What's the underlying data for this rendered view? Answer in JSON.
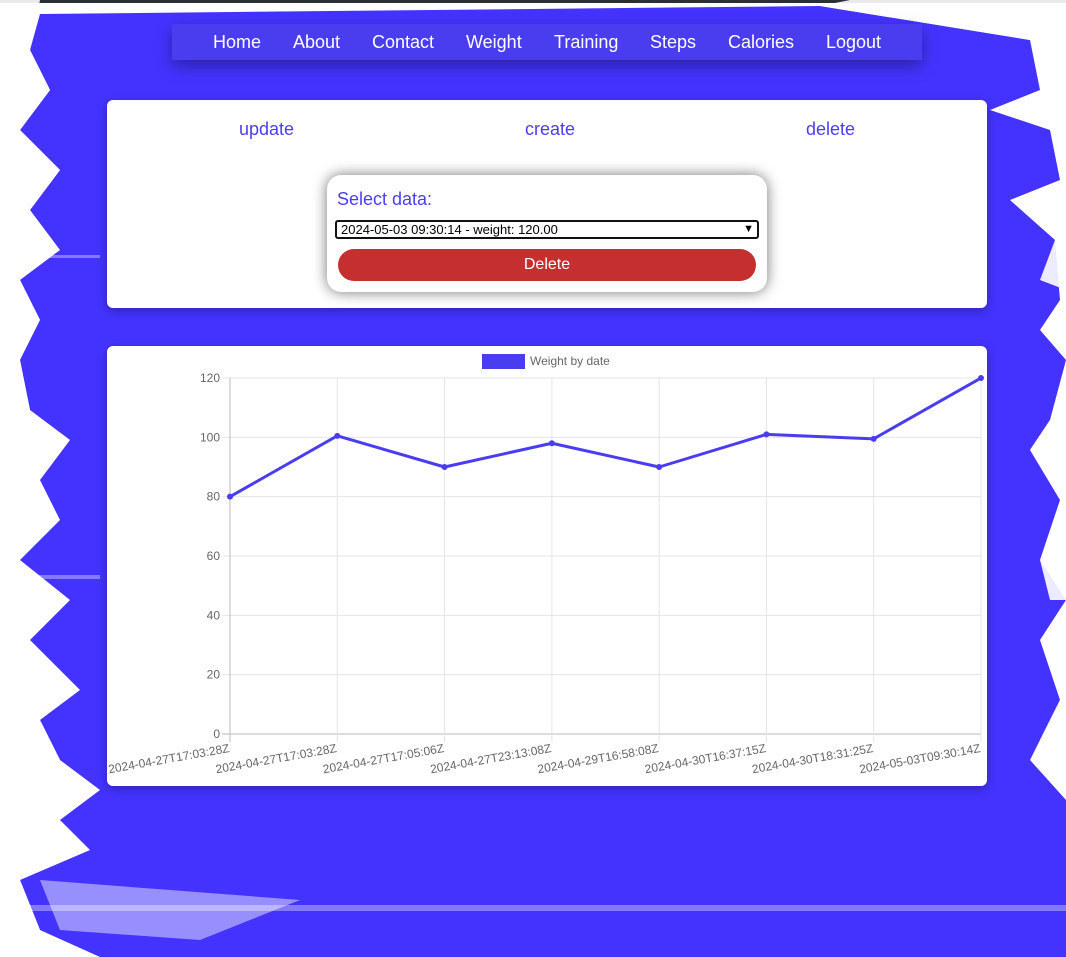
{
  "nav": {
    "items": [
      "Home",
      "About",
      "Contact",
      "Weight",
      "Training",
      "Steps",
      "Calories",
      "Logout"
    ]
  },
  "crud": {
    "update": "update",
    "create": "create",
    "delete": "delete"
  },
  "form": {
    "label": "Select data:",
    "selected_option": "2024-05-03 09:30:14 - weight: 120.00",
    "delete_button": "Delete"
  },
  "colors": {
    "accent": "#4a3df0",
    "delete": "#c62f2f"
  },
  "icons": {
    "select_arrow": "chevron-down-icon"
  },
  "chart_data": {
    "type": "line",
    "legend": "Weight by date",
    "legend_position": "top",
    "categories": [
      "2024-04-27T17:03:28Z",
      "2024-04-27T17:03:28Z",
      "2024-04-27T17:05:06Z",
      "2024-04-27T23:13:08Z",
      "2024-04-29T16:58:08Z",
      "2024-04-30T16:37:15Z",
      "2024-04-30T18:31:25Z",
      "2024-05-03T09:30:14Z"
    ],
    "series": [
      {
        "name": "Weight by date",
        "values": [
          80,
          100.5,
          90,
          98,
          90,
          101,
          99.5,
          120
        ]
      }
    ],
    "y_ticks": [
      "120",
      "100",
      "80",
      "60",
      "40",
      "20",
      "0"
    ],
    "ylim": [
      0,
      120
    ],
    "grid": true
  }
}
